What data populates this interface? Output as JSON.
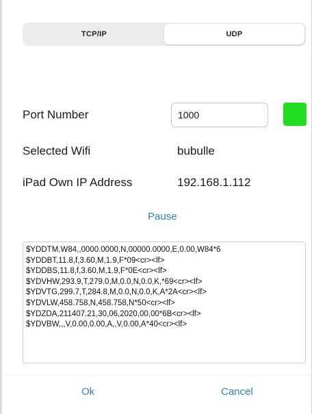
{
  "tabs": [
    {
      "label": "TCP/IP",
      "active": false
    },
    {
      "label": "UDP",
      "active": true
    }
  ],
  "port": {
    "label": "Port Number",
    "value": "1000",
    "status_color": "#22dd22"
  },
  "wifi": {
    "label": "Selected Wifi",
    "value": "bubulle"
  },
  "ip": {
    "label": "iPad Own IP Address",
    "value": "192.168.1.112"
  },
  "pause_label": "Pause",
  "log_lines": [
    "$YDDTM,W84,,0000.0000,N,00000.0000,E,0.00,W84*6",
    "$YDDBT,11.8,f,3.60,M,1.9,F*09<cr><lf>",
    "$YDDBS,11.8,f,3.60,M,1.9,F*0E<cr><lf>",
    "$YDVHW,293.9,T,279.0,M,0.0,N,0.0,K,*69<cr><lf>",
    "$YDVTG,299.7,T,284.8,M,0.0,N,0.0,K,A*2A<cr><lf>",
    "$YDVLW,458.758,N,458.758,N*50<cr><lf>",
    "$YDZDA,211407.21,30,06,2020,00,00*6B<cr><lf>",
    "$YDVBW,,,V,0.00,0.00,A,,V,0.00,A*40<cr><lf>"
  ],
  "buttons": {
    "ok_label": "Ok",
    "cancel_label": "Cancel"
  },
  "colors": {
    "accent": "#2f7fd0",
    "status_ok": "#22dd22"
  }
}
